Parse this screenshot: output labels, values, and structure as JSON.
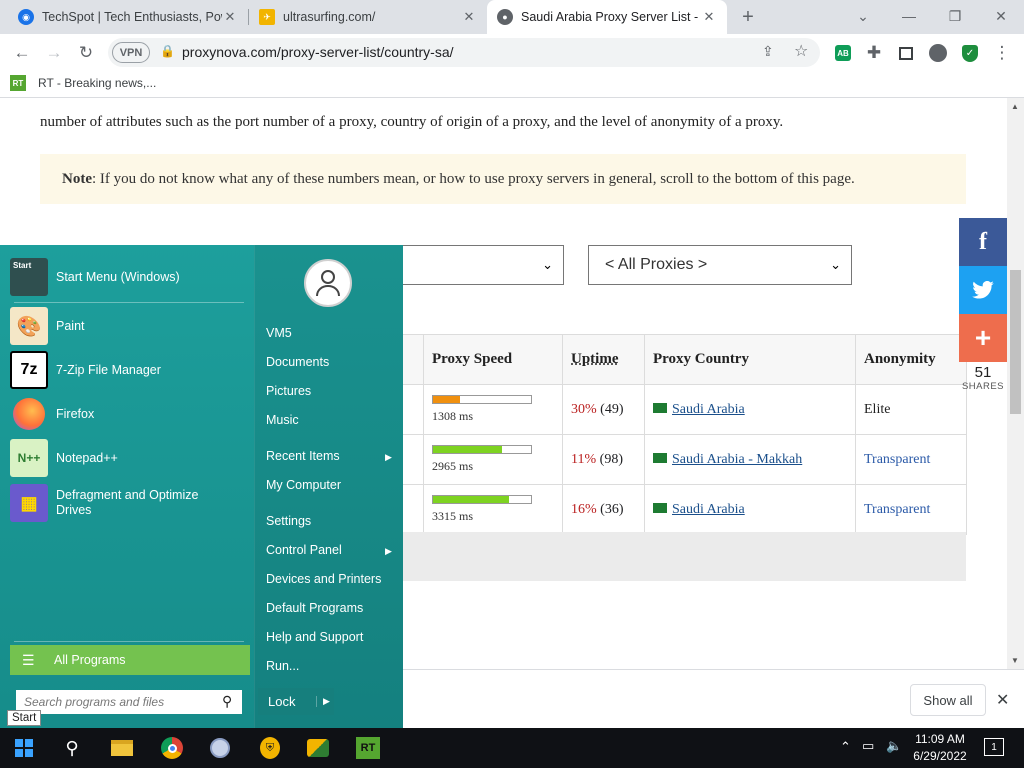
{
  "browser": {
    "tabs": [
      {
        "title": "TechSpot | Tech Enthusiasts, Pow",
        "icon": "techspot-icon",
        "color": "#1a73e8",
        "close": "✕"
      },
      {
        "title": "ultrasurfing.com/",
        "icon": "ultrasurf-icon",
        "color": "#f2b400",
        "close": "✕"
      },
      {
        "title": "Saudi Arabia Proxy Server List - S",
        "icon": "globe-icon",
        "color": "#5f6368",
        "close": "✕"
      }
    ],
    "new_tab": "+",
    "window_controls": [
      "⌄",
      "—",
      "❐",
      "✕"
    ],
    "url": "proxynova.com/proxy-server-list/country-sa/",
    "vpn_label": "VPN",
    "bookmark": "RT - Breaking news,..."
  },
  "page": {
    "paragraph_line2": "number of attributes such as the port number of a proxy, country of origin of a proxy, and the level of anonymity of a proxy.",
    "note_label": "Note",
    "note_text": ": If you do not know what any of these numbers mean, or how to use proxy servers in general, scroll to the bottom of this page.",
    "filter_select_value": "< All Proxies >",
    "table_headers": [
      "Proxy Speed",
      "Uptime",
      "Proxy Country",
      "Anonymity"
    ],
    "rows": [
      {
        "speed_ms": "1308 ms",
        "speed_fraction": 0.28,
        "speed_color": "#f0900f",
        "uptime_pct": "30%",
        "uptime_count": "(49)",
        "country": "Saudi Arabia",
        "anonymity": "Elite"
      },
      {
        "speed_ms": "2965 ms",
        "speed_fraction": 0.7,
        "speed_color": "#7ed321",
        "uptime_pct": "11%",
        "uptime_count": "(98)",
        "country": "Saudi Arabia - Makkah",
        "anonymity": "Transparent"
      },
      {
        "speed_ms": "3315 ms",
        "speed_fraction": 0.78,
        "speed_color": "#7ed321",
        "uptime_pct": "16%",
        "uptime_count": "(36)",
        "country": "Saudi Arabia",
        "anonymity": "Transparent"
      }
    ],
    "share": {
      "buttons": [
        {
          "icon": "facebook-icon",
          "glyph": "f",
          "color": "#3b5998"
        },
        {
          "icon": "twitter-icon",
          "glyph": "t",
          "color": "#1da1f2"
        },
        {
          "icon": "plus-icon",
          "glyph": "+",
          "color": "#ee6d4d"
        }
      ],
      "count": "51",
      "label": "SHARES"
    }
  },
  "download_shelf": {
    "show_all": "Show all",
    "close": "✕"
  },
  "start_menu": {
    "programs": [
      {
        "label": "Start Menu (Windows)",
        "icon": "start-menu-icon",
        "color": "#2f4f4f"
      },
      {
        "label": "Paint",
        "icon": "paint-icon",
        "color": "#f4e7c7"
      },
      {
        "label": "7-Zip File Manager",
        "icon": "7zip-icon",
        "color": "#ffffff"
      },
      {
        "label": "Firefox",
        "icon": "firefox-icon",
        "color": "#ff7139"
      },
      {
        "label": "Notepad++",
        "icon": "notepad-icon",
        "color": "#d9f2c4"
      },
      {
        "label": "Defragment and Optimize Drives",
        "icon": "defrag-icon",
        "color": "#6a5acd"
      }
    ],
    "all_programs": "All Programs",
    "search_placeholder": "Search programs and files",
    "right_links": [
      "VM5",
      "Documents",
      "Pictures",
      "Music",
      "Recent Items",
      "My Computer",
      "Settings",
      "Control Panel",
      "Devices and Printers",
      "Default Programs",
      "Help and Support",
      "Run..."
    ],
    "lock": "Lock",
    "start_tooltip": "Start"
  },
  "taskbar": {
    "time": "11:09 AM",
    "date": "6/29/2022",
    "notification_count": "1",
    "apps": [
      {
        "icon": "search-icon"
      },
      {
        "icon": "file-explorer-icon"
      },
      {
        "icon": "chrome-icon"
      },
      {
        "icon": "app-icon"
      },
      {
        "icon": "vpn-shield-icon"
      },
      {
        "icon": "ultrasurf-icon"
      },
      {
        "icon": "rt-news-icon",
        "label": "RT"
      }
    ]
  }
}
